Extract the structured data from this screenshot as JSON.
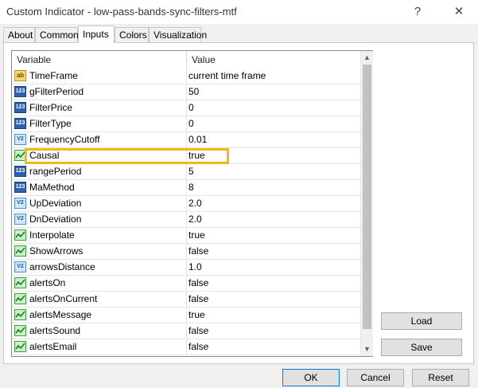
{
  "window": {
    "title": "Custom Indicator - low-pass-bands-sync-filters-mtf",
    "help_label": "?",
    "close_label": "✕"
  },
  "tabs": [
    {
      "label": "About",
      "active": false
    },
    {
      "label": "Common",
      "active": false
    },
    {
      "label": "Inputs",
      "active": true
    },
    {
      "label": "Colors",
      "active": false
    },
    {
      "label": "Visualization",
      "active": false
    }
  ],
  "grid": {
    "columns": [
      "Variable",
      "Value"
    ],
    "rows": [
      {
        "type": "str",
        "icon_text": "ab",
        "name": "TimeFrame",
        "value": "current time frame"
      },
      {
        "type": "int",
        "icon_text": "123",
        "name": "gFilterPeriod",
        "value": "50"
      },
      {
        "type": "int",
        "icon_text": "123",
        "name": "FilterPrice",
        "value": "0"
      },
      {
        "type": "int",
        "icon_text": "123",
        "name": "FilterType",
        "value": "0"
      },
      {
        "type": "dbl",
        "icon_text": "V2",
        "name": "FrequencyCutoff",
        "value": "0.01"
      },
      {
        "type": "bool",
        "icon_text": "",
        "name": "Causal",
        "value": "true"
      },
      {
        "type": "int",
        "icon_text": "123",
        "name": "rangePeriod",
        "value": "5"
      },
      {
        "type": "int",
        "icon_text": "123",
        "name": "MaMethod",
        "value": "8"
      },
      {
        "type": "dbl",
        "icon_text": "V2",
        "name": "UpDeviation",
        "value": "2.0"
      },
      {
        "type": "dbl",
        "icon_text": "V2",
        "name": "DnDeviation",
        "value": "2.0"
      },
      {
        "type": "bool",
        "icon_text": "",
        "name": "Interpolate",
        "value": "true"
      },
      {
        "type": "bool",
        "icon_text": "",
        "name": "ShowArrows",
        "value": "false"
      },
      {
        "type": "dbl",
        "icon_text": "V2",
        "name": "arrowsDistance",
        "value": "1.0"
      },
      {
        "type": "bool",
        "icon_text": "",
        "name": "alertsOn",
        "value": "false"
      },
      {
        "type": "bool",
        "icon_text": "",
        "name": "alertsOnCurrent",
        "value": "false"
      },
      {
        "type": "bool",
        "icon_text": "",
        "name": "alertsMessage",
        "value": "true"
      },
      {
        "type": "bool",
        "icon_text": "",
        "name": "alertsSound",
        "value": "false"
      },
      {
        "type": "bool",
        "icon_text": "",
        "name": "alertsEmail",
        "value": "false"
      }
    ],
    "scroll_up": "▲",
    "scroll_down": "▼"
  },
  "side_buttons": {
    "load_label": "Load",
    "save_label": "Save"
  },
  "footer_buttons": {
    "ok_label": "OK",
    "cancel_label": "Cancel",
    "reset_label": "Reset"
  },
  "colors": {
    "highlight": "#f2b90f",
    "focus": "#0078d7"
  }
}
